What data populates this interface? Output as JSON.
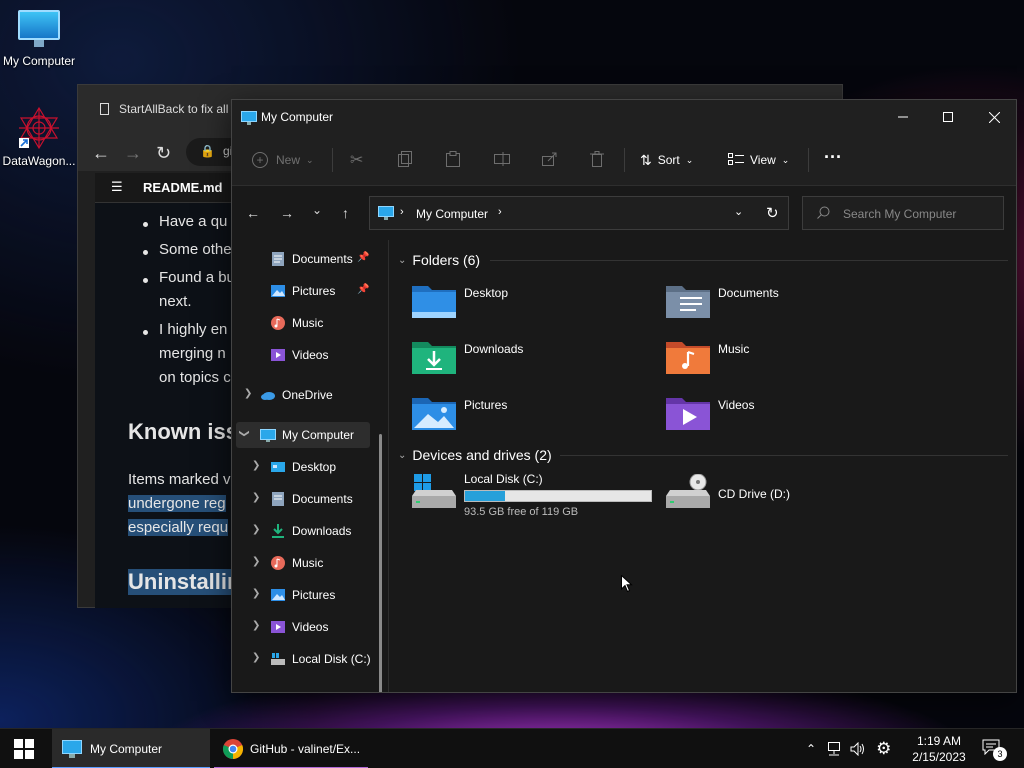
{
  "desktop": {
    "icons": [
      {
        "label": "My Computer",
        "icon": "monitor-icon"
      },
      {
        "label": "DataWagon...",
        "icon": "datawagon-icon"
      }
    ]
  },
  "browser": {
    "tab_title": "StartAllBack to fix all",
    "address": "gi",
    "readme_label": "README.md",
    "bullets": [
      "Have a qu",
      "Some othe",
      "Found a bu",
      "next.",
      "I highly en",
      "merging n",
      "on topics c"
    ],
    "heading_known": "Known iss",
    "para_lines": [
      "Items marked v",
      "undergone reg",
      "especially requ"
    ],
    "heading_uninstall": "Uninstallin"
  },
  "explorer": {
    "title": "My Computer",
    "toolbar": {
      "new_label": "New",
      "sort_label": "Sort",
      "view_label": "View",
      "more_label": "···"
    },
    "address": {
      "location": "My Computer"
    },
    "search": {
      "placeholder": "Search My Computer"
    },
    "nav_pane": {
      "quick_access": [
        {
          "label": "Documents",
          "pinned": true
        },
        {
          "label": "Pictures",
          "pinned": true
        },
        {
          "label": "Music",
          "pinned": false
        },
        {
          "label": "Videos",
          "pinned": false
        }
      ],
      "onedrive": "OneDrive",
      "this_pc": "My Computer",
      "this_pc_children": [
        "Desktop",
        "Documents",
        "Downloads",
        "Music",
        "Pictures",
        "Videos",
        "Local Disk (C:)"
      ]
    },
    "folders_group": "Folders (6)",
    "folders": [
      {
        "name": "Desktop",
        "color": "#2f8fe6"
      },
      {
        "name": "Documents",
        "color": "#7b8fa8"
      },
      {
        "name": "Downloads",
        "color": "#1fb47d"
      },
      {
        "name": "Music",
        "color": "#f07a3b"
      },
      {
        "name": "Pictures",
        "color": "#2d8ee6"
      },
      {
        "name": "Videos",
        "color": "#8a54d6"
      }
    ],
    "drives_group": "Devices and drives (2)",
    "drives": [
      {
        "name": "Local Disk (C:)",
        "free_text": "93.5 GB free of 119 GB",
        "used_fraction": 0.214
      },
      {
        "name": "CD Drive (D:)"
      }
    ]
  },
  "taskbar": {
    "apps": [
      {
        "label": "My Computer",
        "active": true
      },
      {
        "label": "GitHub - valinet/Ex...",
        "active": false
      }
    ],
    "time": "1:19 AM",
    "date": "2/15/2023",
    "notification_count": "3",
    "accent": "#5a9bff"
  }
}
